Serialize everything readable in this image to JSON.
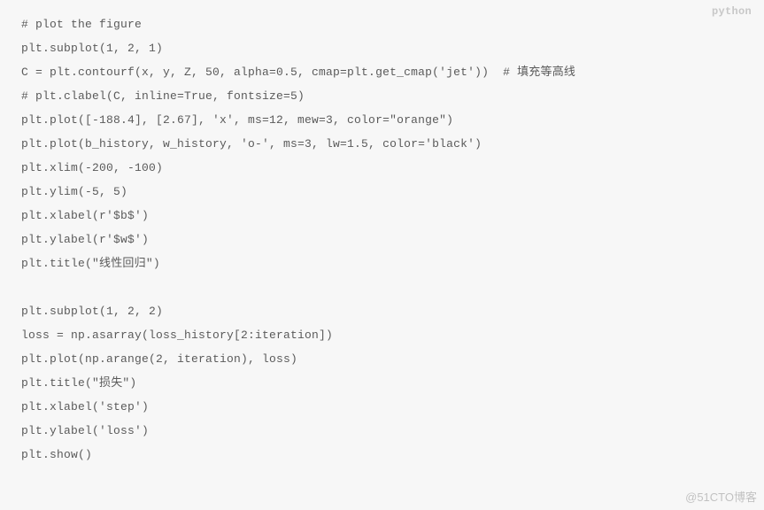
{
  "language_label": "python",
  "watermark_text": "@51CTO博客",
  "code_lines": [
    "# plot the figure",
    "plt.subplot(1, 2, 1)",
    "C = plt.contourf(x, y, Z, 50, alpha=0.5, cmap=plt.get_cmap('jet'))  # 填充等高线",
    "# plt.clabel(C, inline=True, fontsize=5)",
    "plt.plot([-188.4], [2.67], 'x', ms=12, mew=3, color=\"orange\")",
    "plt.plot(b_history, w_history, 'o-', ms=3, lw=1.5, color='black')",
    "plt.xlim(-200, -100)",
    "plt.ylim(-5, 5)",
    "plt.xlabel(r'$b$')",
    "plt.ylabel(r'$w$')",
    "plt.title(\"线性回归\")",
    "",
    "plt.subplot(1, 2, 2)",
    "loss = np.asarray(loss_history[2:iteration])",
    "plt.plot(np.arange(2, iteration), loss)",
    "plt.title(\"损失\")",
    "plt.xlabel('step')",
    "plt.ylabel('loss')",
    "plt.show()"
  ]
}
